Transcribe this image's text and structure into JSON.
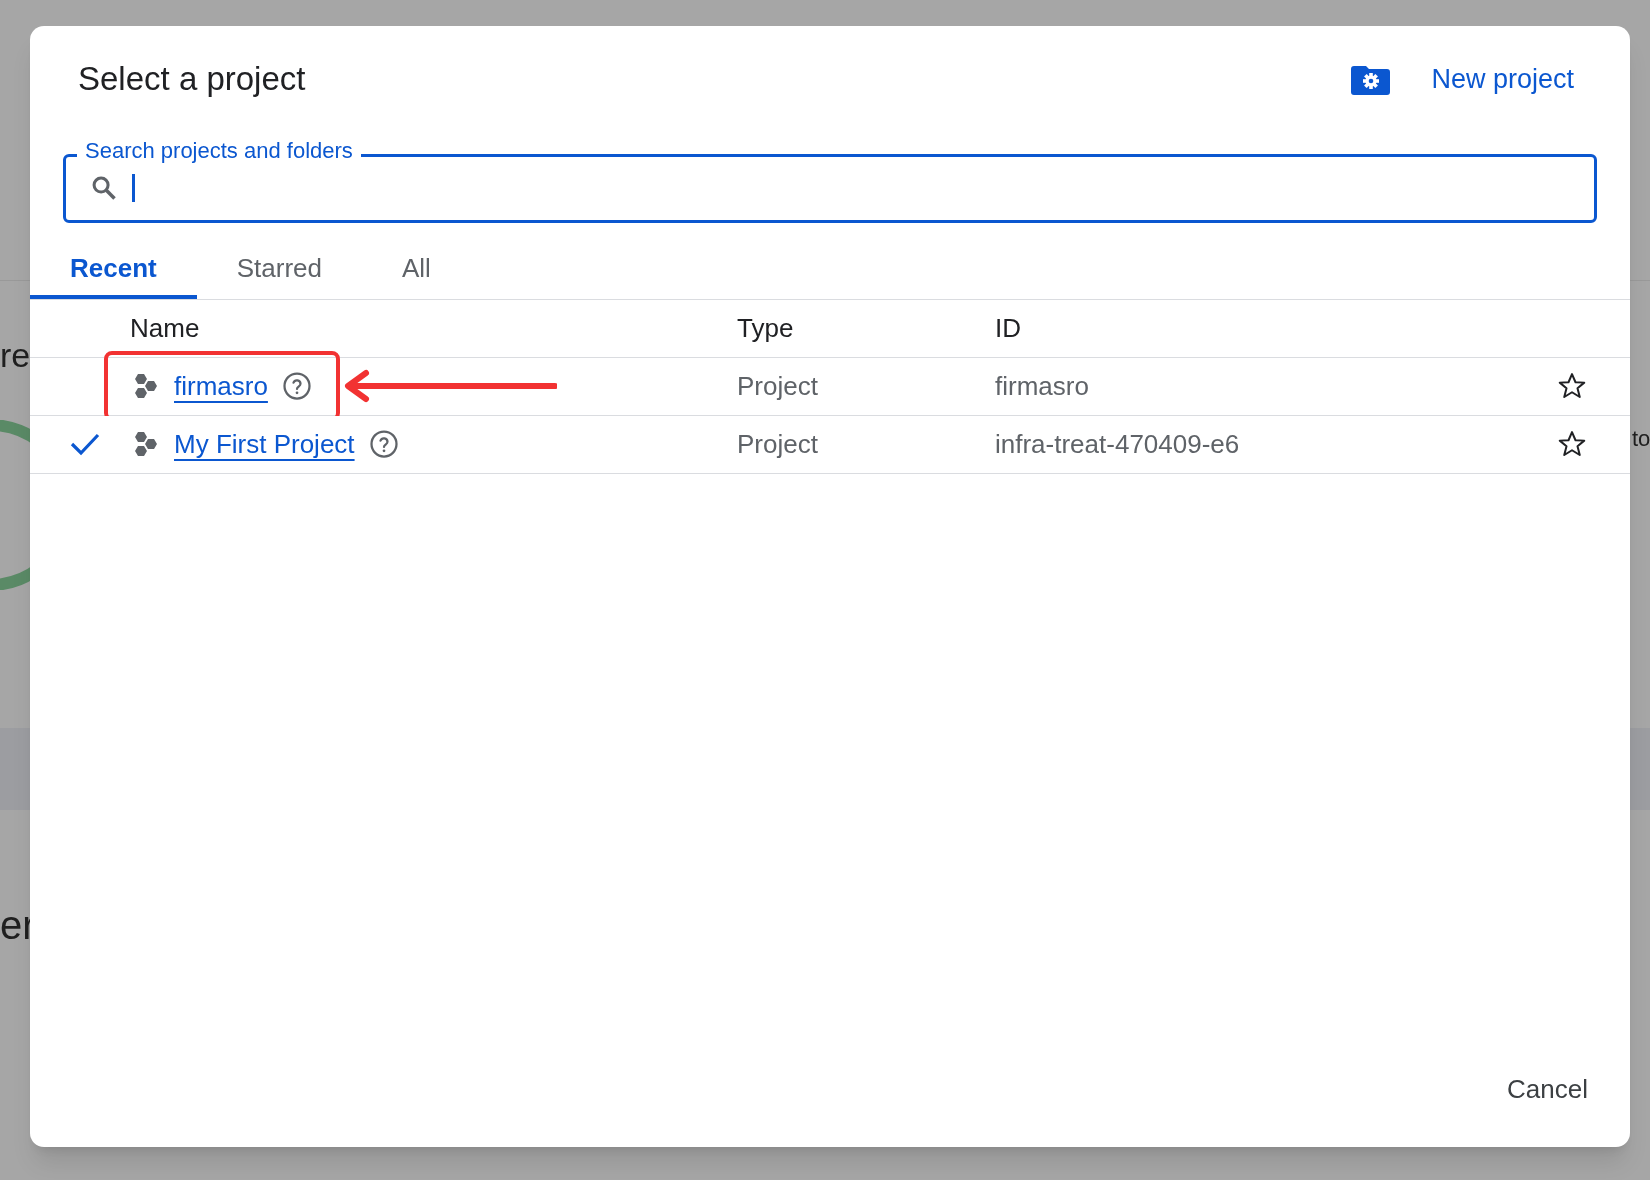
{
  "background": {
    "fragments": [
      "re",
      "er",
      "to"
    ]
  },
  "dialog": {
    "title": "Select a project",
    "new_project": "New project",
    "search": {
      "label": "Search projects and folders",
      "focused": true
    },
    "tabs": [
      {
        "label": "Recent",
        "selected": true
      },
      {
        "label": "Starred",
        "selected": false
      },
      {
        "label": "All",
        "selected": false
      }
    ],
    "table": {
      "columns": [
        "Name",
        "Type",
        "ID"
      ],
      "rows": [
        {
          "name": "firmasro",
          "type": "Project",
          "id": "firmasro",
          "current": false,
          "starred": false,
          "highlighted": true
        },
        {
          "name": "My First Project",
          "type": "Project",
          "id": "infra-treat-470409-e6",
          "current": true,
          "starred": false,
          "highlighted": false
        }
      ]
    },
    "cancel": "Cancel"
  }
}
